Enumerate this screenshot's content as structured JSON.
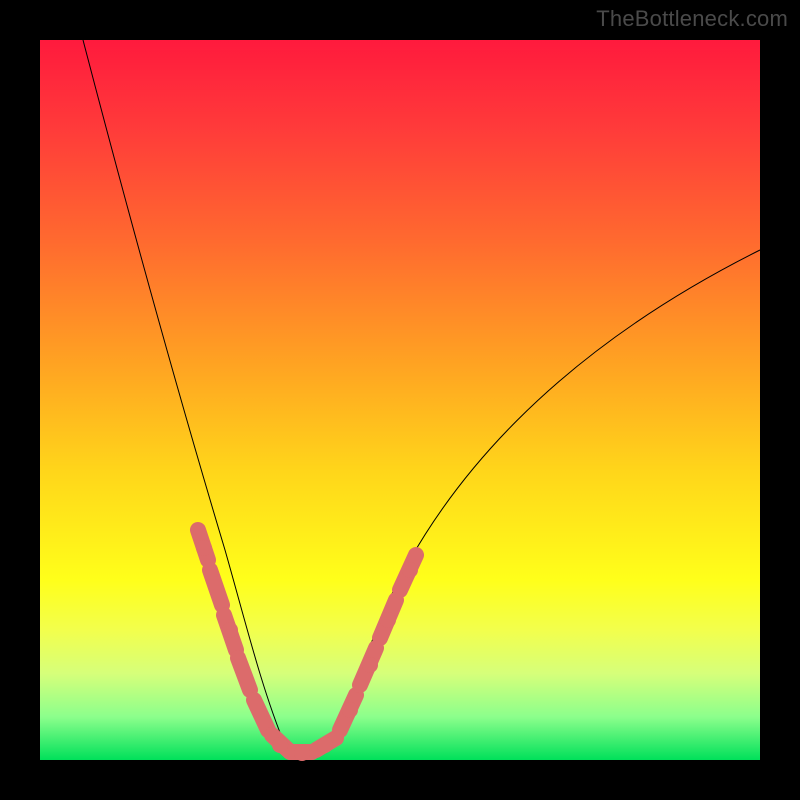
{
  "watermark": "TheBottleneck.com",
  "colors": {
    "accent": "#dc6b6b",
    "curve": "#000000",
    "frame": "#000000",
    "gradient_top": "#ff1a3d",
    "gradient_bottom": "#00e05a"
  },
  "chart_data": {
    "type": "line",
    "title": "",
    "xlabel": "",
    "ylabel": "",
    "xlim": [
      0,
      100
    ],
    "ylim": [
      0,
      100
    ],
    "grid": false,
    "legend": false,
    "series": [
      {
        "name": "bottleneck-curve",
        "x": [
          6,
          10,
          14,
          18,
          22,
          25,
          27,
          29,
          30,
          31,
          32,
          33,
          34,
          35,
          36,
          37,
          38,
          39,
          40,
          44,
          50,
          58,
          66,
          74,
          82,
          90,
          100
        ],
        "y": [
          100,
          82,
          64,
          47,
          32,
          21,
          14,
          8,
          5,
          3,
          1.5,
          0.8,
          0.4,
          0.2,
          0.4,
          0.8,
          1.5,
          3,
          5,
          12,
          22,
          33,
          42,
          50,
          57,
          63,
          70
        ]
      }
    ],
    "accent_segments": [
      {
        "side": "left",
        "x_range": [
          22,
          30
        ],
        "y_range": [
          32,
          5
        ]
      },
      {
        "side": "floor",
        "x_range": [
          30,
          40
        ],
        "y_range": [
          5,
          5
        ]
      },
      {
        "side": "right",
        "x_range": [
          40,
          50
        ],
        "y_range": [
          5,
          22
        ]
      }
    ],
    "notes": "V-shaped bottleneck curve on a full-spectrum vertical gradient; axes unlabeled; values estimated from pixel positions."
  }
}
